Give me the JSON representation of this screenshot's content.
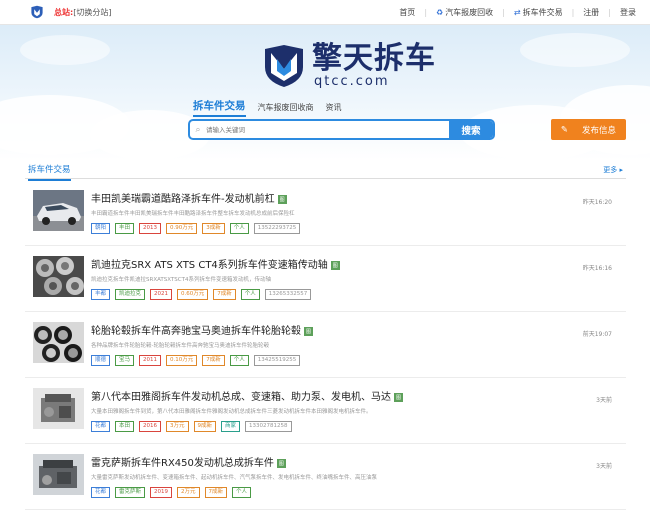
{
  "topbar": {
    "station": "总站",
    "switch_label": "[切换分站]",
    "links": [
      {
        "label": "首页",
        "icon": ""
      },
      {
        "label": "汽车报废回收",
        "icon": "recycle-icon"
      },
      {
        "label": "拆车件交易",
        "icon": "exchange-icon"
      },
      {
        "label": "注册",
        "icon": ""
      },
      {
        "label": "登录",
        "icon": ""
      }
    ]
  },
  "brand": {
    "name": "擎天拆车",
    "domain": "qtcc.com"
  },
  "search": {
    "tabs": [
      "拆车件交易",
      "汽车报废回收商",
      "资讯"
    ],
    "placeholder": "请输入关键词",
    "button": "搜索",
    "publish": "发布信息"
  },
  "section": {
    "title": "拆车件交易",
    "more": "更多 ▸"
  },
  "items": [
    {
      "title": "丰田凯美瑞霸道酷路泽拆车件-发动机前杠",
      "badge": "图",
      "desc": "丰田霸道拆车件丰田凯美瑞拆车件丰田酷路泽拆车件整车拆车发动机总成前后保险杠",
      "tags": [
        {
          "text": "朝阳",
          "color": "blue"
        },
        {
          "text": "丰田",
          "color": "green"
        },
        {
          "text": "2013",
          "color": "red"
        },
        {
          "text": "0.90万元",
          "color": "orange"
        },
        {
          "text": "3成新",
          "color": "orange"
        },
        {
          "text": "个人",
          "color": "green"
        },
        {
          "text": "13522293725",
          "color": "grey"
        }
      ],
      "time": "昨天16:20",
      "thumb": "car-white"
    },
    {
      "title": "凯迪拉克SRX ATS XTS CT4系列拆车件变速箱传动轴",
      "badge": "图",
      "desc": "凯迪拉克拆车件凯迪拉SRXATSXTSCT4系列拆车件变速箱发动机，传动轴",
      "tags": [
        {
          "text": "丰都",
          "color": "blue"
        },
        {
          "text": "凯迪拉克",
          "color": "green"
        },
        {
          "text": "2021",
          "color": "red"
        },
        {
          "text": "0.60万元",
          "color": "orange"
        },
        {
          "text": "7成新",
          "color": "orange"
        },
        {
          "text": "个人",
          "color": "green"
        },
        {
          "text": "13265332557",
          "color": "grey"
        }
      ],
      "time": "昨天16:16",
      "thumb": "wheels"
    },
    {
      "title": "轮胎轮毂拆车件高奔驰宝马奥迪拆车件轮胎轮毂",
      "badge": "图",
      "desc": "各种品牌拆车件轮胎轮毂-轮胎轮毂拆车件高奔驰宝马奥迪拆车件轮胎轮毂",
      "tags": [
        {
          "text": "顺德",
          "color": "blue"
        },
        {
          "text": "宝马",
          "color": "green"
        },
        {
          "text": "2011",
          "color": "red"
        },
        {
          "text": "0.10万元",
          "color": "orange"
        },
        {
          "text": "7成新",
          "color": "orange"
        },
        {
          "text": "个人",
          "color": "green"
        },
        {
          "text": "13425519255",
          "color": "grey"
        }
      ],
      "time": "前天19:07",
      "thumb": "tires"
    },
    {
      "title": "第八代本田雅阁拆车件发动机总成、变速箱、助力泵、发电机、马达",
      "badge": "图",
      "desc": "大量本田雅阁拆车件到货，第八代本田雅阁拆车件雅阁发动机总成拆车件三菱发动机拆车件本田雅阁发电机拆车件。",
      "tags": [
        {
          "text": "花都",
          "color": "blue"
        },
        {
          "text": "本田",
          "color": "green"
        },
        {
          "text": "2016",
          "color": "red"
        },
        {
          "text": "3万元",
          "color": "orange"
        },
        {
          "text": "9成新",
          "color": "orange"
        },
        {
          "text": "商家",
          "color": "teal"
        },
        {
          "text": "13302781258",
          "color": "grey"
        }
      ],
      "time": "3天前",
      "thumb": "engine"
    },
    {
      "title": "雷克萨斯拆车件RX450发动机总成拆车件",
      "badge": "图",
      "desc": "大量雷克萨斯发动机拆车件、变速箱拆车件、起动机拆车件、汽气泵拆车件、发电机拆车件、终油嘴拆车件、高压油泵",
      "tags": [
        {
          "text": "花都",
          "color": "blue"
        },
        {
          "text": "雷克萨斯",
          "color": "green"
        },
        {
          "text": "2019",
          "color": "red"
        },
        {
          "text": "2万元",
          "color": "orange"
        },
        {
          "text": "7成新",
          "color": "orange"
        },
        {
          "text": "个人",
          "color": "green"
        }
      ],
      "time": "3天前",
      "thumb": "engine2"
    }
  ]
}
